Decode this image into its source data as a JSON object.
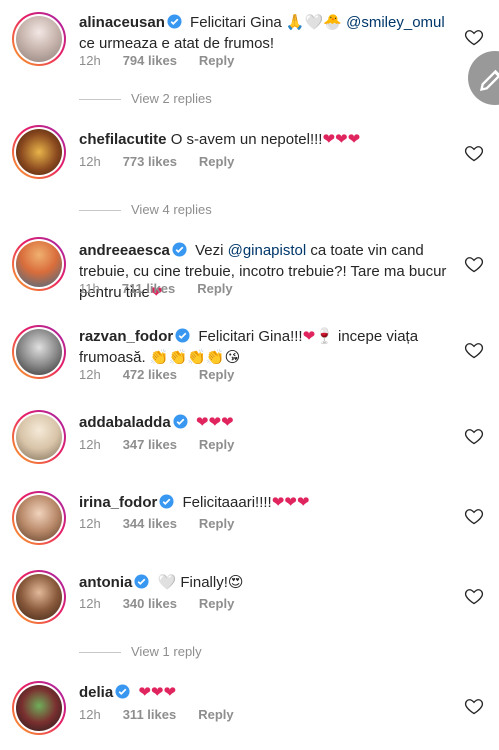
{
  "comments": [
    {
      "username": "alinaceusan",
      "verified": true,
      "text_a": " Felicitari Gina 🙏🤍🐣 ",
      "mention": "@smiley_omul",
      "text_b": " ce urmeaza e atat de frumos!",
      "time": "12h",
      "likes": "794 likes",
      "reply": "Reply",
      "avatar_color": "#c9b7b0"
    },
    {
      "username": "chefilacutite",
      "verified": false,
      "text_a": " O s-avem un nepotel!!!",
      "hearts": "❤❤❤",
      "time": "12h",
      "likes": "773 likes",
      "reply": "Reply",
      "avatar_color": "#6b3a1f"
    },
    {
      "username": "andreeaesca",
      "verified": true,
      "text_a": " Vezi ",
      "mention": "@ginapistol",
      "text_b": " ca toate vin cand trebuie, cu cine trebuie, incotro trebuie?! Tare ma bucur pentru tine",
      "hearts": "❤",
      "time": "11h",
      "likes": "711 likes",
      "reply": "Reply",
      "avatar_color": "#d96d3b"
    },
    {
      "username": "razvan_fodor",
      "verified": true,
      "text_a": " Felicitari Gina!!!",
      "hearts": "❤",
      "text_b": "🍷 incepe viața frumoasă. 👏👏👏👏😘",
      "time": "12h",
      "likes": "472 likes",
      "reply": "Reply",
      "avatar_color": "#5a5a5a"
    },
    {
      "username": "addabaladda",
      "verified": true,
      "hearts": "❤❤❤",
      "time": "12h",
      "likes": "347 likes",
      "reply": "Reply",
      "avatar_color": "#d8c4a8"
    },
    {
      "username": "irina_fodor",
      "verified": true,
      "text_a": " Felicitaaari!!!!",
      "hearts": "❤❤❤",
      "time": "12h",
      "likes": "344 likes",
      "reply": "Reply",
      "avatar_color": "#b98a6a"
    },
    {
      "username": "antonia",
      "verified": true,
      "text_a": " 🤍 Finally!😍",
      "time": "12h",
      "likes": "340 likes",
      "reply": "Reply",
      "avatar_color": "#8a5a3c"
    },
    {
      "username": "delia",
      "verified": true,
      "hearts": "❤❤❤",
      "time": "12h",
      "likes": "311 likes",
      "reply": "Reply",
      "avatar_color": "#7a2f2f"
    }
  ],
  "replies": [
    {
      "label": "View 2 replies"
    },
    {
      "label": "View 4 replies"
    },
    {
      "label": "View 1 reply"
    }
  ],
  "icons": {
    "like": "heart-outline-icon",
    "verified": "verified-badge-icon",
    "compose": "pencil-icon"
  },
  "colors": {
    "verified": "#3897f0",
    "mention": "#00376b",
    "muted": "#8e8e8e",
    "heart": "#e0245e"
  }
}
